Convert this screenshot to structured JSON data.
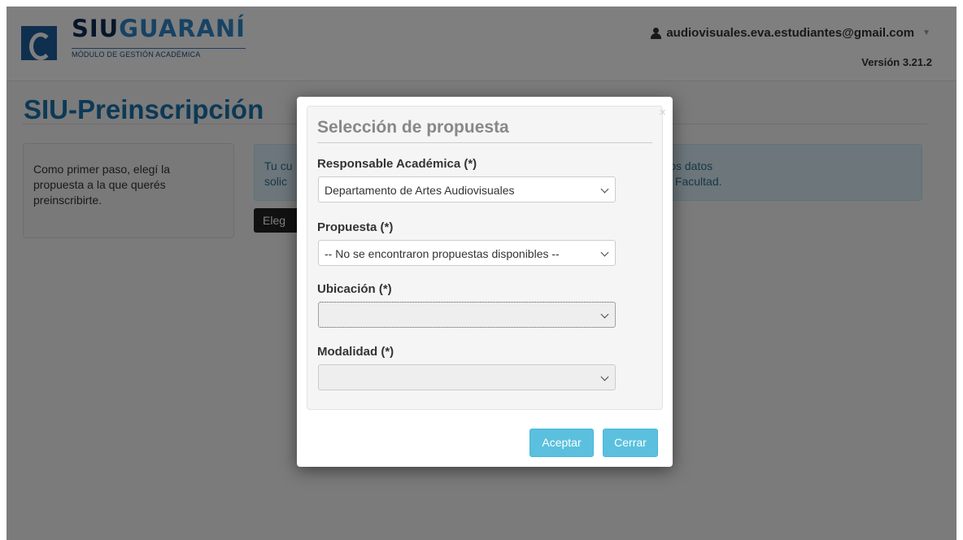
{
  "header": {
    "logo": {
      "part1": "SIU",
      "part2": "GUARANÍ",
      "subtitle": "MÓDULO DE GESTIÓN ACADÉMICA"
    },
    "user_email": "audiovisuales.eva.estudiantes@gmail.com",
    "version": "Versión 3.21.2",
    "icons": {
      "user": "person-icon",
      "caret": "caret-down-icon"
    }
  },
  "page": {
    "title": "SIU-Preinscripción",
    "side_text": "Como primer paso, elegí la propuesta a la que querés preinscribirte.",
    "info_line1": "Tu cu                                                                                  esta. Luego, completá los datos",
    "info_line2": "solic                                                                                     Sección Alumnos de tu Facultad.",
    "choose_button": "Eleg"
  },
  "modal": {
    "close_glyph": "×",
    "legend": "Selección de propuesta",
    "fields": [
      {
        "label": "Responsable Académica (*)",
        "value": "Departamento de Artes Audiovisuales"
      },
      {
        "label": "Propuesta (*)",
        "value": "-- No se encontraron propuestas disponibles --"
      },
      {
        "label": "Ubicación (*)",
        "value": ""
      },
      {
        "label": "Modalidad (*)",
        "value": ""
      }
    ],
    "accept_button": "Aceptar",
    "close_button": "Cerrar"
  },
  "colors": {
    "title": "#1a72ad",
    "info_bg": "#d9edf7",
    "button_info": "#5bc0de",
    "overlay": "rgba(0,0,0,0.5)"
  }
}
